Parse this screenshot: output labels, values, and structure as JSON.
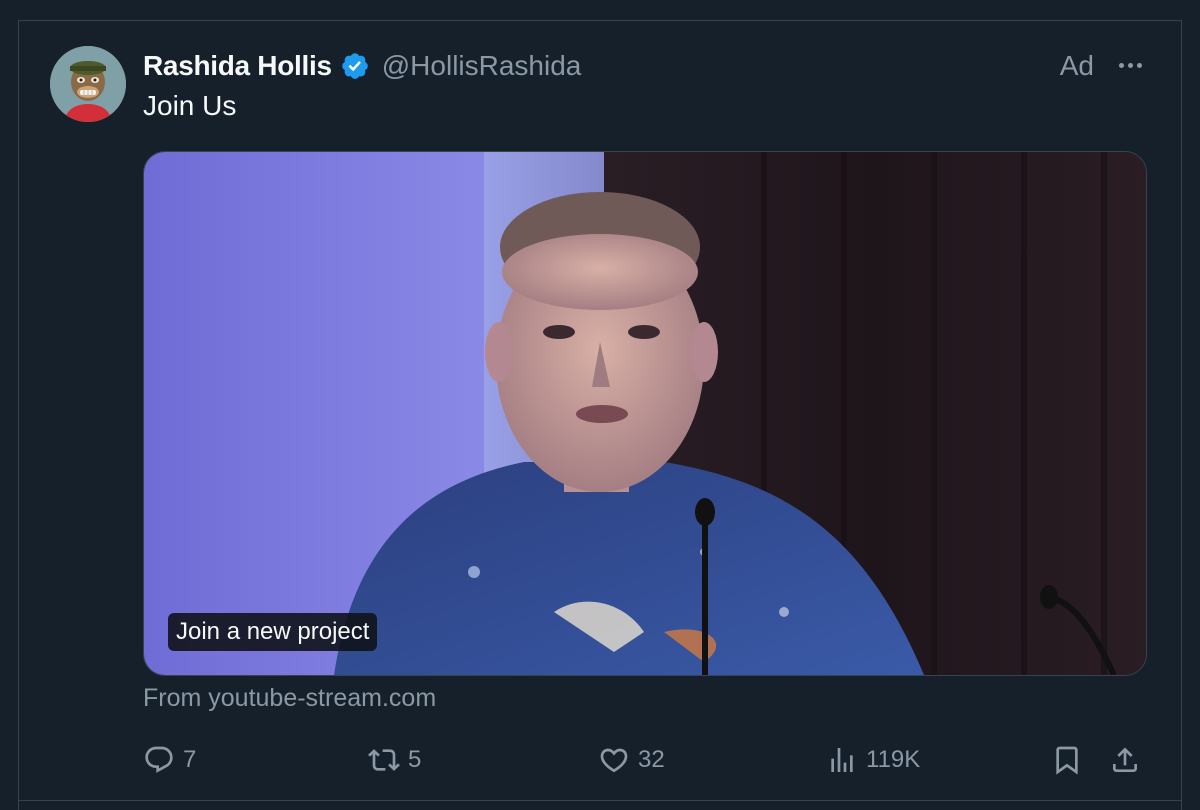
{
  "post": {
    "author_name": "Rashida Hollis",
    "author_handle": "@HollisRashida",
    "ad_label": "Ad",
    "text": "Join Us",
    "media_caption": "Join a new project",
    "source": "From youtube-stream.com"
  },
  "actions": {
    "replies": "7",
    "reposts": "5",
    "likes": "32",
    "views": "119K"
  },
  "colors": {
    "background": "#15202b",
    "text_primary": "#f7f9f9",
    "text_secondary": "#8b98a5",
    "verified": "#1d9bf0",
    "border": "#38444d"
  },
  "icons": [
    "verified-badge-icon",
    "more-icon",
    "reply-icon",
    "repost-icon",
    "like-icon",
    "views-icon",
    "bookmark-icon",
    "share-icon"
  ]
}
